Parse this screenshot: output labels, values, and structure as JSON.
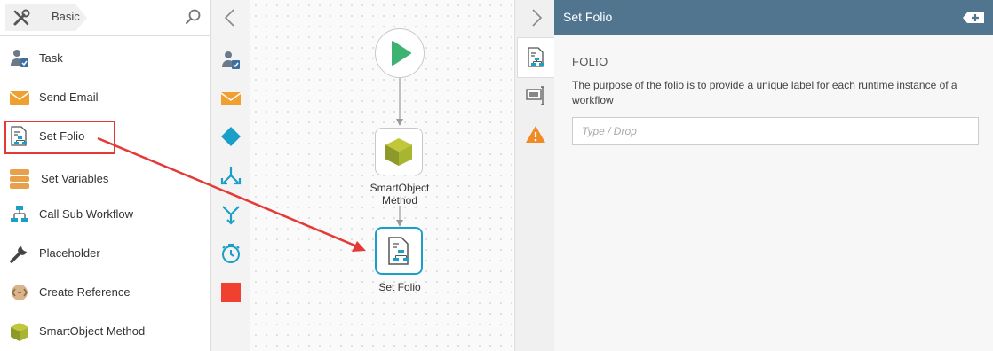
{
  "toolbox": {
    "category": "Basic",
    "items": [
      {
        "label": "Task",
        "icon": "task-icon"
      },
      {
        "label": "Send Email",
        "icon": "email-icon"
      },
      {
        "label": "Set Folio",
        "icon": "set-folio-icon"
      },
      {
        "label": "Set Variables",
        "icon": "set-variables-icon"
      },
      {
        "label": "Call Sub Workflow",
        "icon": "sub-workflow-icon"
      },
      {
        "label": "Placeholder",
        "icon": "wrench-icon"
      },
      {
        "label": "Create Reference",
        "icon": "create-reference-icon"
      },
      {
        "label": "SmartObject Method",
        "icon": "smartobject-icon"
      }
    ]
  },
  "canvas": {
    "nodes": [
      {
        "label": "",
        "icon": "start-icon"
      },
      {
        "label": "SmartObject\nMethod",
        "icon": "smartobject-icon"
      },
      {
        "label": "Set Folio",
        "icon": "set-folio-icon"
      }
    ]
  },
  "panel": {
    "title": "Set Folio",
    "section_label": "FOLIO",
    "description": "The purpose of the folio is to provide a unique label for each runtime instance of a workflow",
    "input_value": "",
    "input_placeholder": "Type / Drop"
  },
  "colors": {
    "panel_header": "#51758f",
    "highlight": "#e53935",
    "start_green": "#3cb371",
    "accent_teal": "#1aa0c8",
    "email_orange": "#f0a030",
    "warning_orange": "#f08a24"
  }
}
